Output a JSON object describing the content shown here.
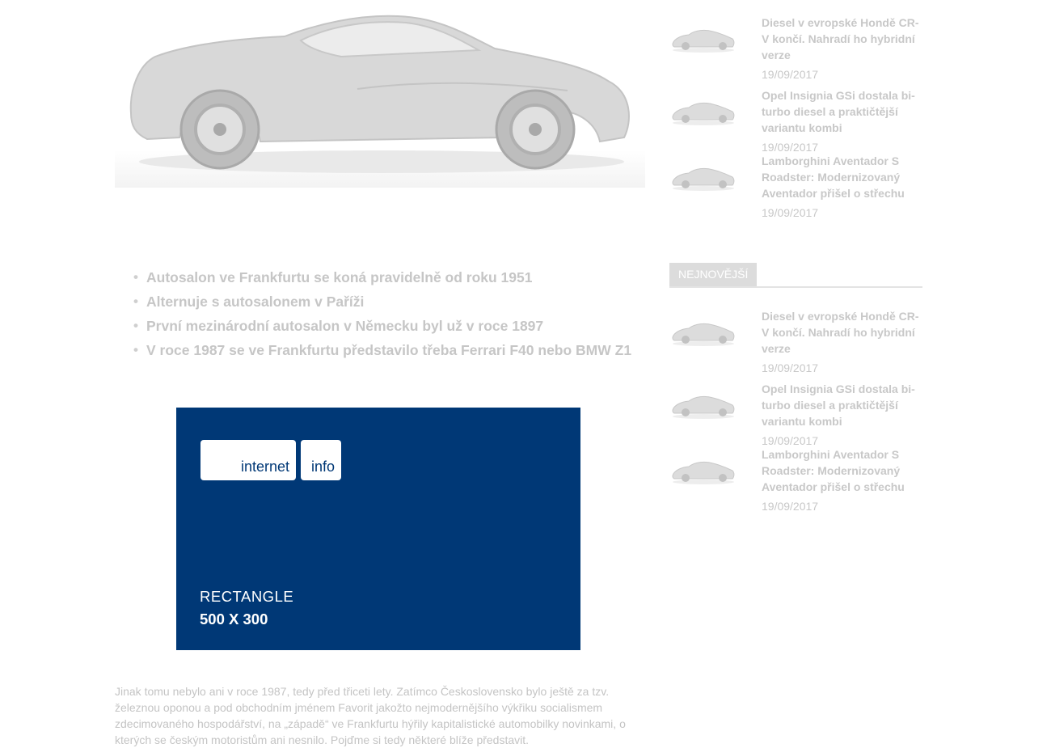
{
  "hero": {
    "icon": "car-hero-image"
  },
  "bullets": [
    "Autosalon ve Frankfurtu se koná pravidelně od roku 1951",
    "Alternuje s autosalonem v Paříži",
    "První mezinárodní autosalon v Německu byl už v roce 1897",
    "V roce 1987 se ve Frankfurtu představilo třeba Ferrari F40 nebo BMW Z1"
  ],
  "ad": {
    "logo_word1": "internet",
    "logo_word2": "info",
    "label": "RECTANGLE",
    "size": "500 X 300",
    "background_color": "#003876"
  },
  "article_text": "Jinak tomu nebylo ani v roce 1987, tedy před třiceti lety. Zatímco Československo bylo ještě za tzv. železnou oponou a pod obchodním jménem Favorit jakožto nejmodernějšího výkřiku socialismem zdecimovaného hospodářství, na „západě“ ve Frankfurtu hýřily kapitalistické automobilky novinkami, o kterých se českým motoristům ani nesnilo. Pojďme si tedy některé blíže představit.",
  "sidebar": {
    "top_items": [
      {
        "title": "Diesel v evropské Hondě CR-V končí. Nahradí ho hybridní verze",
        "date": "19/09/2017"
      },
      {
        "title": "Opel Insignia GSi dostala bi-turbo diesel a praktičtější variantu kombi",
        "date": "19/09/2017"
      },
      {
        "title": "Lamborghini Aventador S Roadster: Modernizovaný Aventador přišel o střechu",
        "date": "19/09/2017"
      }
    ],
    "section_title": "NEJNOVĚJŠÍ",
    "newest_items": [
      {
        "title": "Diesel v evropské Hondě CR-V končí. Nahradí ho hybridní verze",
        "date": "19/09/2017"
      },
      {
        "title": "Opel Insignia GSi dostala bi-turbo diesel a praktičtější variantu kombi",
        "date": "19/09/2017"
      },
      {
        "title": "Lamborghini Aventador S Roadster: Modernizovaný Aventador přišel o střechu",
        "date": "19/09/2017"
      }
    ]
  }
}
